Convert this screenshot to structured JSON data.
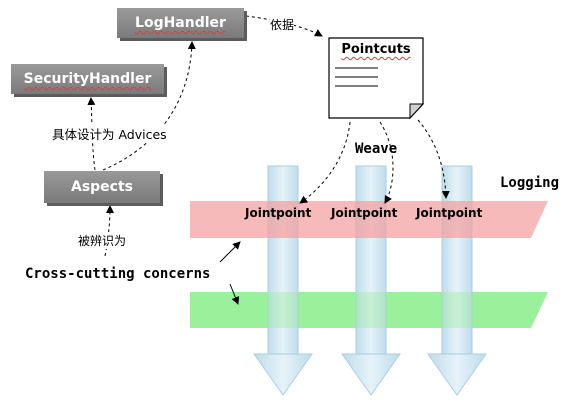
{
  "boxes": {
    "log_handler": "LogHandler",
    "security_handler": "SecurityHandler",
    "aspects": "Aspects"
  },
  "labels": {
    "yiju": "依据",
    "design_as_advices": "具体设计为 Advices",
    "identified_as": "被辨识为",
    "weave": "Weave",
    "logging": "Logging",
    "cross_cutting": "Cross-cutting concerns"
  },
  "pointcuts": {
    "title": "Pointcuts"
  },
  "jointpoints": [
    "Jointpoint",
    "Jointpoint",
    "Jointpoint"
  ],
  "colors": {
    "box": "#8a8a8a",
    "logging_plane": "#f4a0a0",
    "other_plane": "#90ee90",
    "flow_arrow": "#cde6f2"
  }
}
